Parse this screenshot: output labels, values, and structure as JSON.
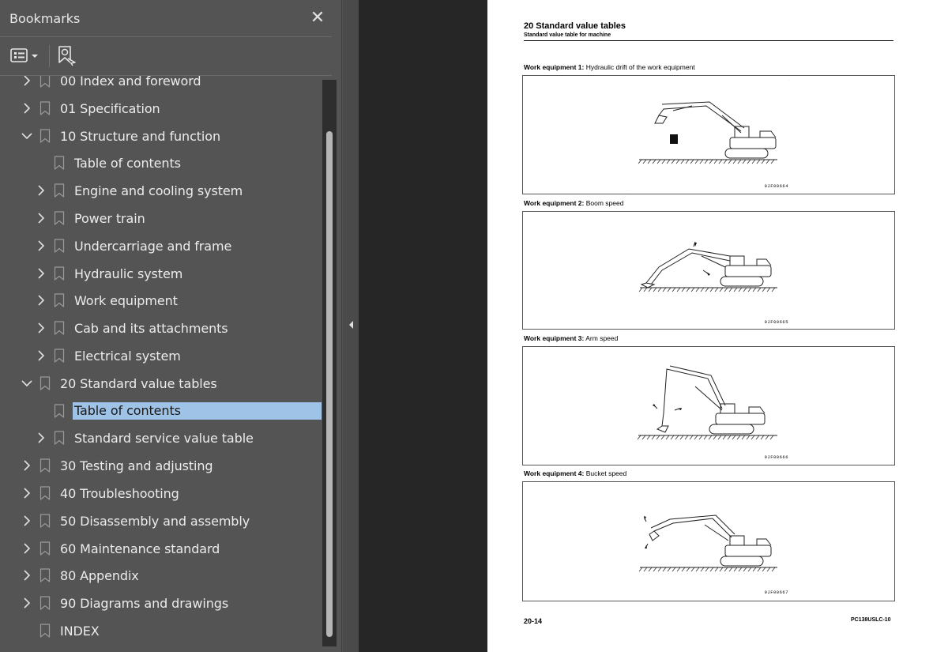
{
  "panel": {
    "title": "Bookmarks",
    "close_glyph": "✕"
  },
  "toolbar": {
    "options_icon": "bookmark-options-icon",
    "find_icon": "find-current-bookmark-icon"
  },
  "bookmarks": [
    {
      "label": "00 Index and foreword",
      "level": 1,
      "expandable": true,
      "expanded": false
    },
    {
      "label": "01 Specification",
      "level": 1,
      "expandable": true,
      "expanded": false
    },
    {
      "label": "10 Structure and function",
      "level": 1,
      "expandable": true,
      "expanded": true
    },
    {
      "label": "Table of contents",
      "level": 2,
      "expandable": false
    },
    {
      "label": "Engine and cooling system",
      "level": 2,
      "expandable": true,
      "expanded": false
    },
    {
      "label": "Power train",
      "level": 2,
      "expandable": true,
      "expanded": false
    },
    {
      "label": "Undercarriage and frame",
      "level": 2,
      "expandable": true,
      "expanded": false
    },
    {
      "label": "Hydraulic system",
      "level": 2,
      "expandable": true,
      "expanded": false
    },
    {
      "label": "Work equipment",
      "level": 2,
      "expandable": true,
      "expanded": false
    },
    {
      "label": "Cab and its attachments",
      "level": 2,
      "expandable": true,
      "expanded": false
    },
    {
      "label": "Electrical system",
      "level": 2,
      "expandable": true,
      "expanded": false
    },
    {
      "label": "20 Standard value tables",
      "level": 1,
      "expandable": true,
      "expanded": true
    },
    {
      "label": "Table of contents",
      "level": 2,
      "expandable": false,
      "selected": true
    },
    {
      "label": "Standard service value table",
      "level": 2,
      "expandable": true,
      "expanded": false
    },
    {
      "label": "30 Testing and adjusting",
      "level": 1,
      "expandable": true,
      "expanded": false
    },
    {
      "label": "40 Troubleshooting",
      "level": 1,
      "expandable": true,
      "expanded": false
    },
    {
      "label": "50 Disassembly and assembly",
      "level": 1,
      "expandable": true,
      "expanded": false
    },
    {
      "label": "60 Maintenance standard",
      "level": 1,
      "expandable": true,
      "expanded": false
    },
    {
      "label": "80 Appendix",
      "level": 1,
      "expandable": true,
      "expanded": false
    },
    {
      "label": "90 Diagrams and drawings",
      "level": 1,
      "expandable": true,
      "expanded": false
    },
    {
      "label": "INDEX",
      "level": 1,
      "expandable": false
    }
  ],
  "colors": {
    "panel_bg": "#545454",
    "selection": "#9ec3e6",
    "doc_bg": "#262626"
  },
  "page": {
    "title": "20 Standard value tables",
    "subtitle": "Standard value table for machine",
    "figures": [
      {
        "caption_bold": "Work equipment 1:",
        "caption": " Hydraulic drift of the work equipment",
        "id": "9JF00664"
      },
      {
        "caption_bold": "Work equipment 2:",
        "caption": " Boom speed",
        "id": "9JF00665"
      },
      {
        "caption_bold": "Work equipment 3:",
        "caption": " Arm speed",
        "id": "9JF00666"
      },
      {
        "caption_bold": "Work equipment 4:",
        "caption": " Bucket speed",
        "id": "9JF00667"
      }
    ],
    "page_number": "20-14",
    "model": "PC138USLC-10"
  }
}
